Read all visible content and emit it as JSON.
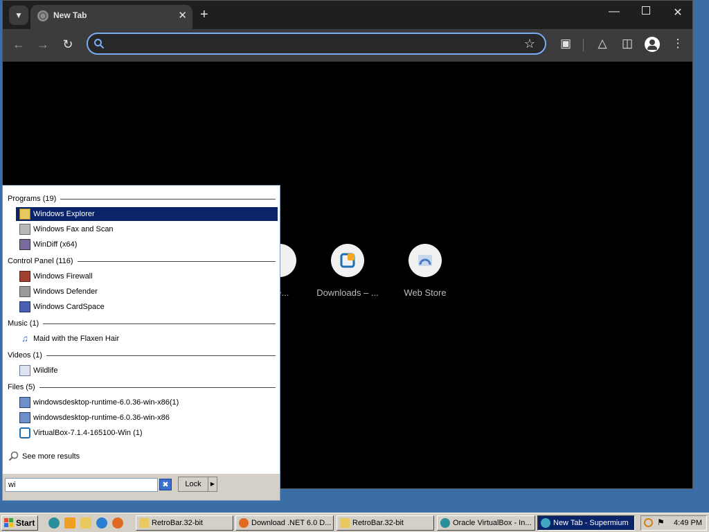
{
  "browser": {
    "tab": {
      "title": "New Tab"
    },
    "omnibox": {
      "value": ""
    },
    "shortcuts": [
      {
        "label": "Se..."
      },
      {
        "label": "Downloads – ..."
      },
      {
        "label": "Web Store"
      }
    ]
  },
  "start_menu": {
    "groups": {
      "programs": "Programs (19)",
      "control_panel": "Control Panel (116)",
      "music": "Music (1)",
      "videos": "Videos (1)",
      "files": "Files (5)"
    },
    "items": {
      "windows_explorer": "Windows Explorer",
      "windows_fax": "Windows Fax and Scan",
      "windiff": "WinDiff (x64)",
      "windows_firewall": "Windows Firewall",
      "windows_defender": "Windows Defender",
      "windows_cardspace": "Windows CardSpace",
      "maid": "Maid with the Flaxen Hair",
      "wildlife": "Wildlife",
      "runtime1": "windowsdesktop-runtime-6.0.36-win-x86(1)",
      "runtime2": "windowsdesktop-runtime-6.0.36-win-x86",
      "virtualbox": "VirtualBox-7.1.4-165100-Win (1)"
    },
    "see_more": "See more results",
    "search_value": "wi",
    "lock_label": "Lock"
  },
  "taskbar": {
    "start_label": "Start",
    "tasks": [
      "RetroBar.32-bit",
      "Download .NET 6.0 D...",
      "RetroBar.32-bit",
      "Oracle VirtualBox - In...",
      "New Tab - Supermium"
    ],
    "clock": "4:49 PM"
  },
  "colors": {
    "desktop": "#3a6ea5",
    "selection": "#0a246a",
    "omnibox_focus": "#7cacf8"
  }
}
